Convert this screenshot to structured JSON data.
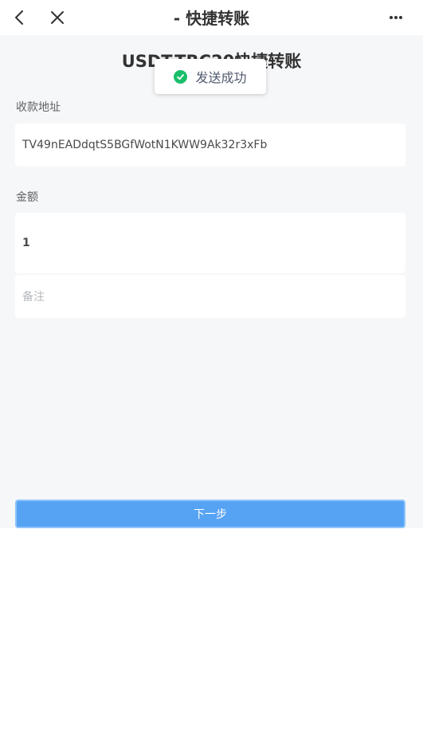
{
  "nav": {
    "title": "- 快捷转账",
    "back_icon": "chevron-left-icon",
    "close_icon": "close-icon",
    "more_icon": "more-horizontal-icon"
  },
  "page": {
    "title": "USDT-TRC20快捷转账"
  },
  "form": {
    "address_label": "收款地址",
    "address_value": "TV49nEADdqtS5BGfWotN1KWW9Ak32r3xFb",
    "amount_label": "金额",
    "amount_value": "1",
    "memo_placeholder": "备注"
  },
  "actions": {
    "next_label": "下一步"
  },
  "toast": {
    "message": "发送成功",
    "icon": "check-circle-icon"
  },
  "colors": {
    "primary": "#57a3f3",
    "success": "#19be6b",
    "background": "#f6f7f9"
  }
}
